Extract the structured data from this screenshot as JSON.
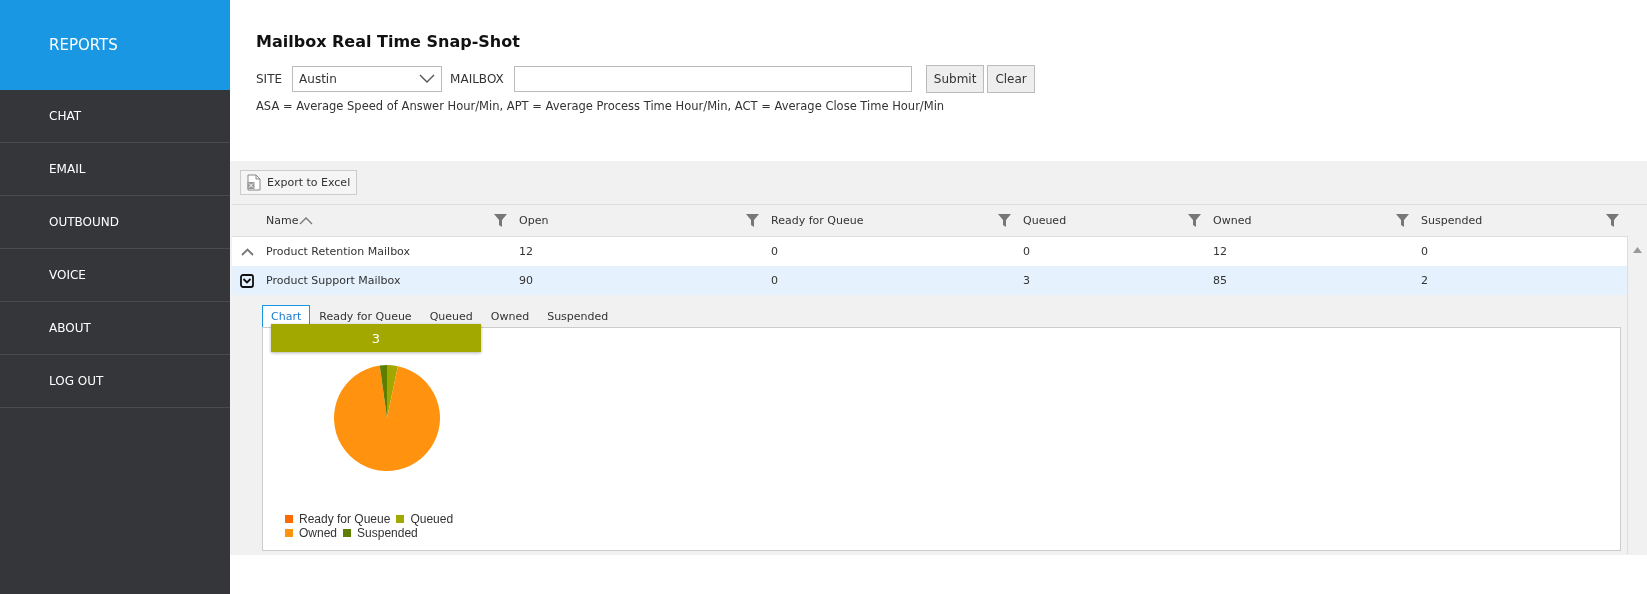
{
  "sidebar": {
    "header": "REPORTS",
    "items": [
      {
        "label": "CHAT"
      },
      {
        "label": "EMAIL"
      },
      {
        "label": "OUTBOUND"
      },
      {
        "label": "VOICE"
      },
      {
        "label": "ABOUT"
      },
      {
        "label": "LOG OUT"
      }
    ]
  },
  "page": {
    "title": "Mailbox Real Time Snap-Shot"
  },
  "form": {
    "site_label": "SITE",
    "site_value": "Austin",
    "mailbox_label": "MAILBOX",
    "buttons": [
      "Submit",
      "Clear"
    ],
    "note": "ASA = Average Speed of Answer Hour/Min, APT = Average Process Time Hour/Min, ACT = Average Close Time Hour/Min"
  },
  "toolbar": {
    "export_button": "Export to Excel"
  },
  "table": {
    "columns": [
      "Name",
      "Open",
      "Ready for Queue",
      "Queued",
      "Owned",
      "Suspended"
    ],
    "rows": [
      {
        "selected": false,
        "cells": [
          "Product Retention Mailbox",
          "12",
          "0",
          "0",
          "12",
          "0"
        ]
      },
      {
        "selected": true,
        "cells": [
          "Product Support Mailbox",
          "90",
          "0",
          "3",
          "85",
          "2"
        ]
      }
    ]
  },
  "detail": {
    "tabs": [
      {
        "label": "Chart",
        "selected": true
      },
      {
        "label": "Ready for Queue",
        "selected": false
      },
      {
        "label": "Queued",
        "selected": false
      },
      {
        "label": "Owned",
        "selected": false
      },
      {
        "label": "Suspended",
        "selected": false
      }
    ],
    "tooltip": {
      "text": "3",
      "color": "#a2a800"
    },
    "chart_data": {
      "type": "pie",
      "categories": [
        "Ready for Queue",
        "Queued",
        "Owned",
        "Suspended"
      ],
      "values": [
        0,
        3.3,
        94.5,
        2.2
      ],
      "legend": "bottom",
      "colors": [
        "#ff6a00",
        "#a2a800",
        "#ff9310",
        "#5e7e00"
      ]
    }
  }
}
